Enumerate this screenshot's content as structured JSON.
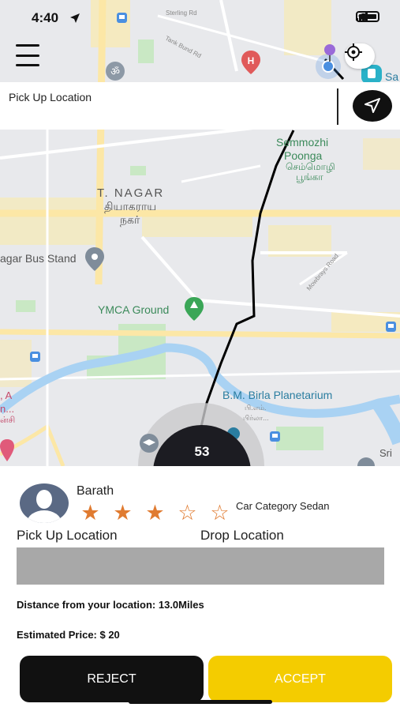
{
  "status_bar": {
    "time": "4:40"
  },
  "map": {
    "labels": {
      "t_nagar": "T. NAGAR",
      "t_nagar_tamil_1": "தியாகராய",
      "t_nagar_tamil_2": "நகர்",
      "semmozhi_1": "Semmozhi",
      "semmozhi_2": "Poonga",
      "semmozhi_tamil_1": "செம்மொழி",
      "semmozhi_tamil_2": "பூங்கா",
      "bus_stand": "agar Bus Stand",
      "ymca": "YMCA Ground",
      "planetarium": "B.M. Birla Planetarium",
      "planetarium_tamil_1": "பி.எம்.",
      "planetarium_tamil_2": "பிர்லா...",
      "sterling": "Sterling Rd",
      "tank_bund": "Tank Bund Rd",
      "mowbrays": "Mowbrays Road",
      "sri": "Sri",
      "left_edge_1": ", A",
      "left_edge_2": "n...",
      "left_edge_3": "ன்சி",
      "sa": "Sa"
    },
    "eta": "53"
  },
  "pickup_bar": {
    "label": "Pick Up Location"
  },
  "request": {
    "driver_name": "Barath",
    "rating": 3,
    "rating_max": 5,
    "car_category": "Car Category Sedan",
    "pickup_label": "Pick Up Location",
    "drop_label": "Drop Location",
    "distance": "Distance from your location: 13.0Miles",
    "price": "Estimated Price: $ 20",
    "reject_label": "REJECT",
    "accept_label": "ACCEPT"
  },
  "colors": {
    "accent": "#f4cc00",
    "star": "#e07b30",
    "route": "#000000",
    "water": "#a9d2f3",
    "park": "#c9e8c4",
    "highway": "#fce7a6"
  }
}
